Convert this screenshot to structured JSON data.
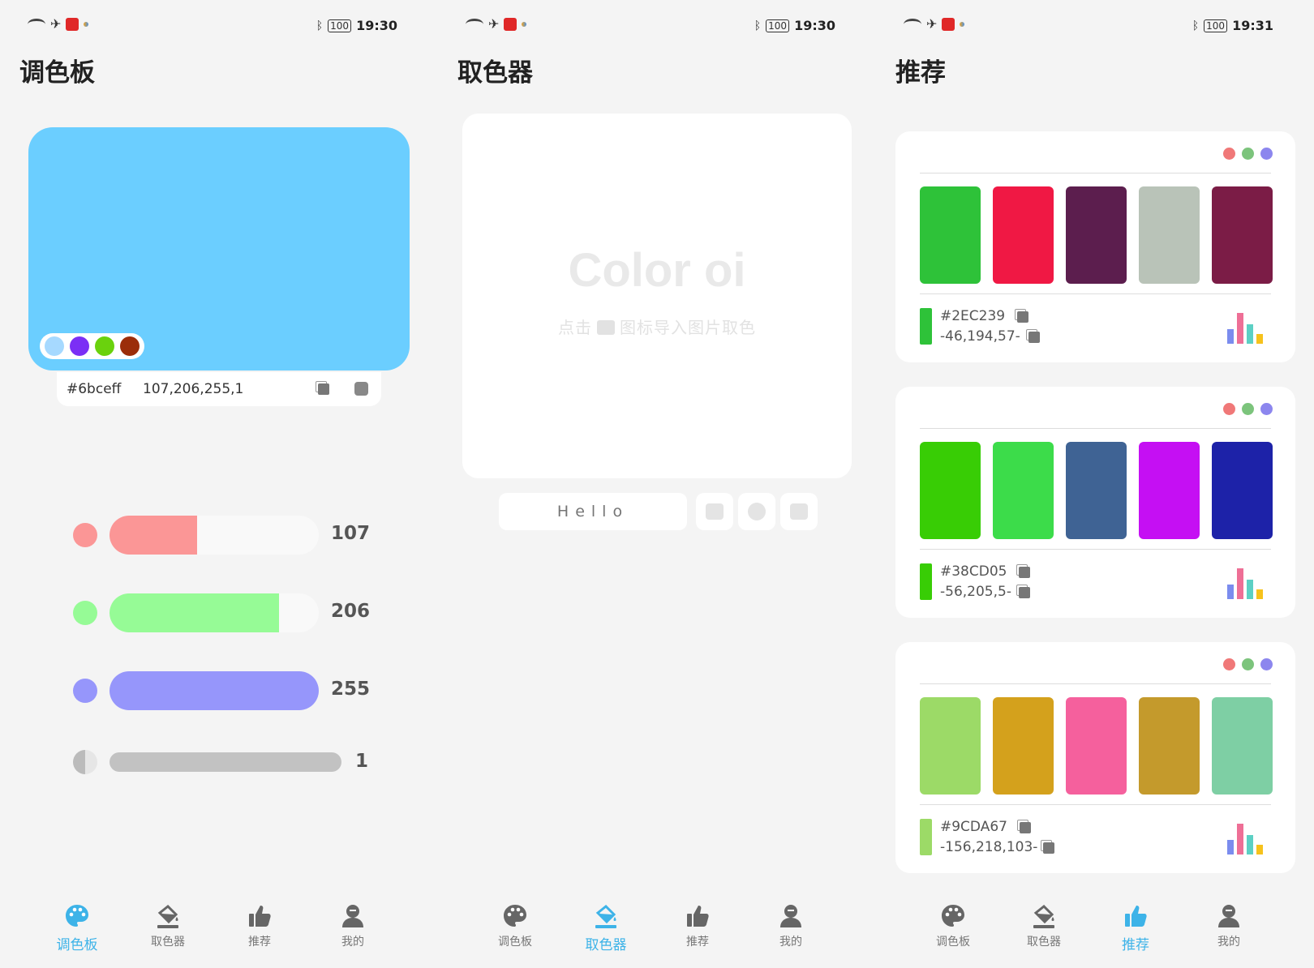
{
  "status_bar": [
    {
      "time": "19:30",
      "battery": "100"
    },
    {
      "time": "19:30",
      "battery": "100"
    },
    {
      "time": "19:31",
      "battery": "100"
    }
  ],
  "palette": {
    "title": "调色板",
    "preview_color": "#6bceff",
    "swatches": [
      "#a6d9ff",
      "#7b2ff5",
      "#6ad20d",
      "#9b2d0a"
    ],
    "hex": "#6bceff",
    "rgba": "107,206,255,1",
    "channels": [
      {
        "name": "red",
        "value": "107",
        "color": "#fb9696",
        "knob": "#fb9696",
        "fraction": 0.42
      },
      {
        "name": "green",
        "value": "206",
        "color": "#96fb96",
        "knob": "#96fb96",
        "fraction": 0.81
      },
      {
        "name": "blue",
        "value": "255",
        "color": "#9696fb",
        "knob": "#9696fb",
        "fraction": 1.0
      }
    ],
    "alpha": {
      "value": "1",
      "fraction": 1.0
    }
  },
  "picker": {
    "title": "取色器",
    "logo": "Color oi",
    "hint_before": "点击",
    "hint_after": "图标导入图片取色",
    "input_placeholder": "Hello"
  },
  "recommend": {
    "title": "推荐",
    "window_dots": [
      "#f07878",
      "#7cc47c",
      "#8c86ee"
    ],
    "chart_colors": [
      "#7b8cee",
      "#ee6f96",
      "#5cd0c4",
      "#f6c21c"
    ],
    "cards": [
      {
        "colors": [
          "#2ec239",
          "#f01844",
          "#5c1e4e",
          "#b9c3b8",
          "#7b1c46"
        ],
        "hex": "#2EC239",
        "rgb": "-46,194,57-",
        "main": "#2ec239"
      },
      {
        "colors": [
          "#38cd05",
          "#3cdc4a",
          "#3f6394",
          "#c50ff3",
          "#1d22a8"
        ],
        "hex": "#38CD05",
        "rgb": "-56,205,5-",
        "main": "#38cd05"
      },
      {
        "colors": [
          "#9cda67",
          "#d4a11c",
          "#f5609d",
          "#c49a2c",
          "#7ecfa4"
        ],
        "hex": "#9CDA67",
        "rgb": "-156,218,103-",
        "main": "#9cda67"
      }
    ]
  },
  "nav": {
    "items": [
      {
        "label": "调色板",
        "icon": "palette-icon"
      },
      {
        "label": "取色器",
        "icon": "paint-bucket-icon"
      },
      {
        "label": "推荐",
        "icon": "thumbs-up-icon"
      },
      {
        "label": "我的",
        "icon": "user-icon"
      }
    ],
    "active_color": "#3db3e8",
    "inactive_color": "#666666"
  }
}
